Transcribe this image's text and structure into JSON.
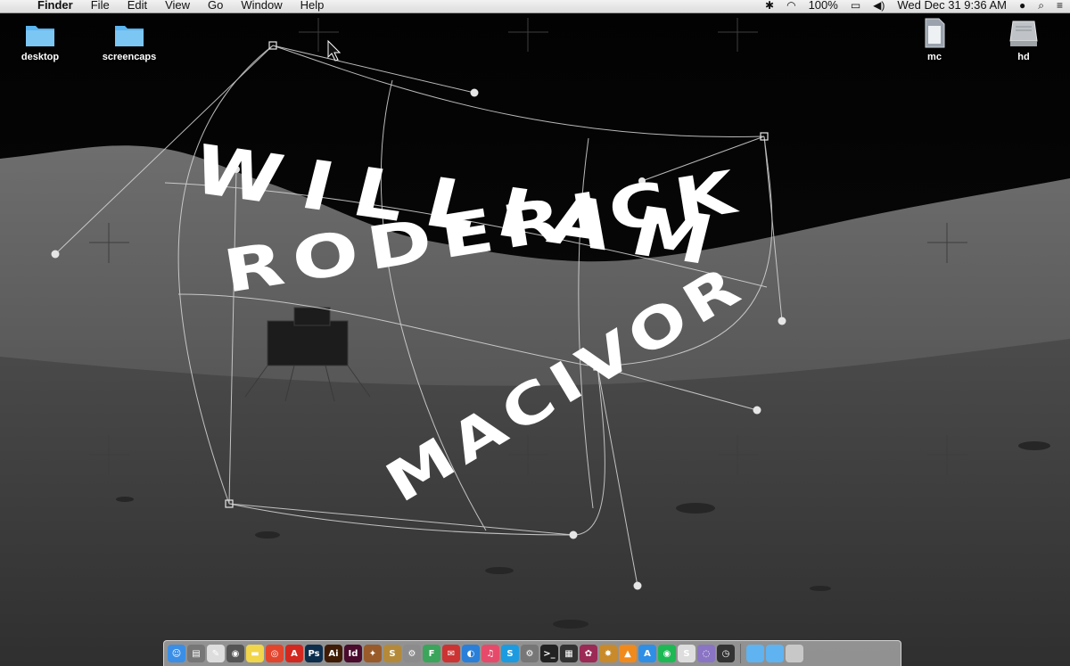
{
  "menubar": {
    "apple_symbol": "",
    "app_name": "Finder",
    "menus": [
      "File",
      "Edit",
      "View",
      "Go",
      "Window",
      "Help"
    ],
    "status": {
      "battery_percent": "100%",
      "clock": "Wed Dec 31  9:36 AM",
      "icons": [
        "bluetooth-icon",
        "wifi-icon",
        "battery-icon",
        "volume-icon",
        "user-icon",
        "spotlight-icon",
        "notification-center-icon"
      ]
    }
  },
  "desktop": {
    "icons": [
      {
        "label": "desktop",
        "kind": "folder"
      },
      {
        "label": "screencaps",
        "kind": "folder"
      },
      {
        "label": "mc",
        "kind": "sd-card"
      },
      {
        "label": "hd",
        "kind": "hard-drive"
      }
    ]
  },
  "artwork": {
    "lines": [
      "WILLIAM",
      "RODERICK",
      "MACIVOR"
    ],
    "text_color": "#ffffff"
  },
  "dock": {
    "apps": [
      {
        "name": "finder",
        "glyph": "☺",
        "color": "#3a8ee6"
      },
      {
        "name": "preview",
        "glyph": "▤",
        "color": "#777777"
      },
      {
        "name": "textedit",
        "glyph": "✎",
        "color": "#dddddd"
      },
      {
        "name": "image-capture",
        "glyph": "◉",
        "color": "#555555"
      },
      {
        "name": "notes",
        "glyph": "▬",
        "color": "#f1d54a"
      },
      {
        "name": "chrome",
        "glyph": "◎",
        "color": "#e3442c"
      },
      {
        "name": "acrobat",
        "glyph": "A",
        "color": "#d2281f"
      },
      {
        "name": "photoshop",
        "glyph": "Ps",
        "color": "#0d2d4d"
      },
      {
        "name": "illustrator",
        "glyph": "Ai",
        "color": "#3f1b06"
      },
      {
        "name": "indesign",
        "glyph": "Id",
        "color": "#4a0b2d"
      },
      {
        "name": "photo-booth",
        "glyph": "✦",
        "color": "#9a5b2a"
      },
      {
        "name": "stickies",
        "glyph": "S",
        "color": "#b48a3a"
      },
      {
        "name": "system-tool",
        "glyph": "⚙",
        "color": "#8c8c8c"
      },
      {
        "name": "fontbook",
        "glyph": "F",
        "color": "#3ba55b"
      },
      {
        "name": "messenger",
        "glyph": "✉",
        "color": "#cc3333"
      },
      {
        "name": "utility-blue",
        "glyph": "◐",
        "color": "#2a7fd8"
      },
      {
        "name": "itunes",
        "glyph": "♫",
        "color": "#e64a6a"
      },
      {
        "name": "skype",
        "glyph": "S",
        "color": "#1d9be0"
      },
      {
        "name": "system-preferences",
        "glyph": "⚙",
        "color": "#777777"
      },
      {
        "name": "terminal",
        "glyph": ">_",
        "color": "#222222"
      },
      {
        "name": "clapper",
        "glyph": "▦",
        "color": "#333333"
      },
      {
        "name": "screensaver",
        "glyph": "✿",
        "color": "#9b2a55"
      },
      {
        "name": "pineapple",
        "glyph": "✸",
        "color": "#c88a2a"
      },
      {
        "name": "vlc",
        "glyph": "▲",
        "color": "#f08a1c"
      },
      {
        "name": "app-store",
        "glyph": "A",
        "color": "#2f8fe6"
      },
      {
        "name": "spotify",
        "glyph": "◉",
        "color": "#1db954"
      },
      {
        "name": "sketchbook",
        "glyph": "S",
        "color": "#dddddd"
      },
      {
        "name": "purple-app",
        "glyph": "◌",
        "color": "#8a74c4"
      },
      {
        "name": "timemachine",
        "glyph": "◷",
        "color": "#333333"
      }
    ],
    "stacks": [
      {
        "name": "applications-folder",
        "color": "#5fb3f0"
      },
      {
        "name": "downloads-folder",
        "color": "#5fb3f0"
      },
      {
        "name": "trash",
        "color": "#c8c8c8"
      }
    ]
  },
  "colors": {
    "menubar_bg": "#e6e6e6",
    "folder_blue": "#5bb5ef",
    "sky": "#050505",
    "warp_guide": "#d9d9d9"
  }
}
